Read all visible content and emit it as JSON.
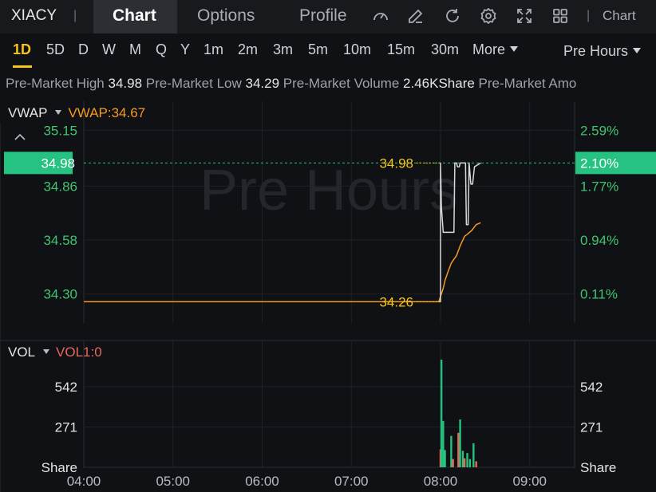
{
  "header": {
    "ticker": "XIACY",
    "tabs": [
      {
        "label": "Chart",
        "active": true
      },
      {
        "label": "Options",
        "active": false
      },
      {
        "label": "Profile",
        "active": false
      }
    ],
    "icons": [
      "gauge-icon",
      "pencil-icon",
      "refresh-icon",
      "gear-icon",
      "fullscreen-icon",
      "grid-icon"
    ],
    "chart_menu": "Chart"
  },
  "periods": {
    "items": [
      "1D",
      "5D",
      "D",
      "W",
      "M",
      "Q",
      "Y",
      "1m",
      "2m",
      "3m",
      "5m",
      "10m",
      "15m",
      "30m",
      "More"
    ],
    "active": "1D",
    "session": "Pre Hours"
  },
  "info": {
    "high_label": "Pre-Market High",
    "high_value": "34.98",
    "low_label": "Pre-Market Low",
    "low_value": "34.29",
    "volume_label": "Pre-Market Volume",
    "volume_value": "2.46KShare",
    "amount_label": "Pre-Market Amo"
  },
  "indicators": {
    "main_name": "VWAP",
    "main_value": "VWAP:34.67",
    "sub_name": "VOL",
    "sub_value": "VOL1:0"
  },
  "watermark": "Pre Hours",
  "colors": {
    "up": "#26c281",
    "down": "#e8685a",
    "vwap": "#f59a23",
    "price": "#d8d8d8",
    "label": "#f5c518",
    "axis": "#40c470"
  },
  "chart_data": [
    {
      "type": "line",
      "title": "",
      "x_ticks": [
        "04:00",
        "05:00",
        "06:00",
        "07:00",
        "08:00",
        "09:00"
      ],
      "y_ticks_left": [
        "35.15",
        "34.86",
        "34.58",
        "34.30"
      ],
      "y_ticks_right": [
        "2.59%",
        "1.77%",
        "0.94%",
        "0.11%"
      ],
      "ylim": [
        34.15,
        35.3
      ],
      "current_price": "34.98",
      "current_pct": "2.10%",
      "annotations": [
        {
          "label": "34.98",
          "t": 8.0,
          "y": 34.98
        },
        {
          "label": "34.26",
          "t": 8.0,
          "y": 34.26
        }
      ],
      "series": [
        {
          "name": "VWAP",
          "t": [
            4.0,
            7.98,
            8.03,
            8.05,
            8.08,
            8.12,
            8.18,
            8.22,
            8.27,
            8.3,
            8.35,
            8.4,
            8.45
          ],
          "values": [
            34.26,
            34.26,
            34.33,
            34.37,
            34.41,
            34.46,
            34.5,
            34.55,
            34.6,
            34.61,
            34.63,
            34.66,
            34.67
          ]
        },
        {
          "t": [
            7.98,
            8.0,
            8.0,
            8.01,
            8.03,
            8.15,
            8.16,
            8.18,
            8.19,
            8.21,
            8.22,
            8.28,
            8.29,
            8.31,
            8.32,
            8.34,
            8.36,
            8.38,
            8.45
          ],
          "values": [
            34.26,
            34.26,
            34.98,
            34.75,
            34.62,
            34.62,
            34.98,
            34.98,
            34.96,
            34.96,
            34.98,
            34.98,
            34.66,
            34.66,
            34.98,
            34.87,
            34.87,
            34.96,
            34.98
          ]
        }
      ]
    },
    {
      "type": "bar",
      "title": "",
      "y_ticks": [
        "542",
        "271"
      ],
      "y_unit": "Share",
      "ylim": [
        0,
        720
      ],
      "bars": [
        {
          "t": 8.0,
          "v": 120,
          "dir": "down"
        },
        {
          "t": 8.01,
          "v": 720,
          "dir": "up"
        },
        {
          "t": 8.03,
          "v": 310,
          "dir": "up"
        },
        {
          "t": 8.05,
          "v": 115,
          "dir": "up"
        },
        {
          "t": 8.12,
          "v": 210,
          "dir": "up"
        },
        {
          "t": 8.14,
          "v": 55,
          "dir": "down"
        },
        {
          "t": 8.2,
          "v": 230,
          "dir": "down"
        },
        {
          "t": 8.22,
          "v": 320,
          "dir": "up"
        },
        {
          "t": 8.25,
          "v": 110,
          "dir": "up"
        },
        {
          "t": 8.27,
          "v": 60,
          "dir": "down"
        },
        {
          "t": 8.3,
          "v": 95,
          "dir": "up"
        },
        {
          "t": 8.33,
          "v": 55,
          "dir": "up"
        },
        {
          "t": 8.37,
          "v": 160,
          "dir": "up"
        },
        {
          "t": 8.4,
          "v": 40,
          "dir": "down"
        }
      ]
    }
  ]
}
